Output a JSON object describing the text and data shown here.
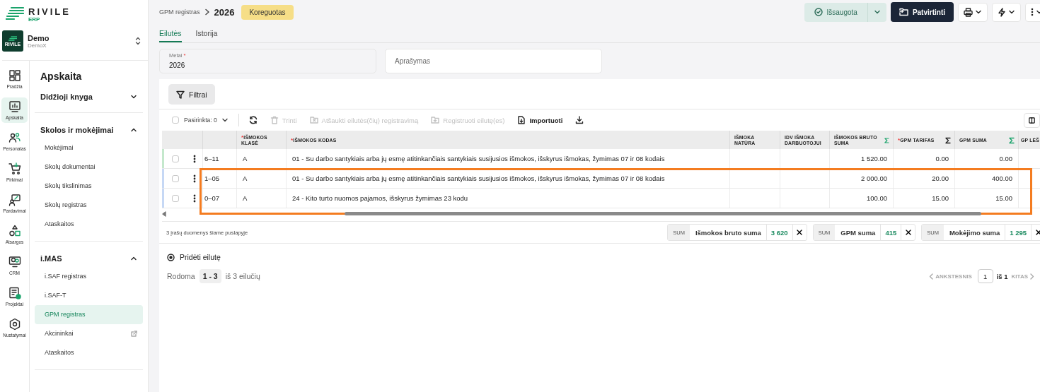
{
  "logo": {
    "name": "RIVILE",
    "product": "ERP"
  },
  "company": {
    "name": "Demo",
    "subtitle": "DemoX",
    "logo_text": "RIVILE"
  },
  "nav_rail": [
    {
      "label": "Pradžia",
      "selected": false
    },
    {
      "label": "Apskaita",
      "selected": true
    },
    {
      "label": "Personalas",
      "selected": false
    },
    {
      "label": "Pirkimai",
      "selected": false
    },
    {
      "label": "Pardavimai",
      "selected": false
    },
    {
      "label": "Atsargos",
      "selected": false
    },
    {
      "label": "CRM",
      "selected": false
    },
    {
      "label": "Projektai",
      "selected": false
    },
    {
      "label": "Nustatymai",
      "selected": false
    }
  ],
  "menu": {
    "title": "Apskaita",
    "groups": [
      {
        "label": "Didžioji knyga",
        "expanded": false
      },
      {
        "label": "Skolos ir mokėjimai",
        "expanded": true,
        "items": [
          {
            "label": "Mokėjimai",
            "selected": false,
            "external": false
          },
          {
            "label": "Skolų dokumentai",
            "selected": false,
            "external": false
          },
          {
            "label": "Skolų tikslinimas",
            "selected": false,
            "external": false
          },
          {
            "label": "Skolų registras",
            "selected": false,
            "external": false
          },
          {
            "label": "Ataskaitos",
            "selected": false,
            "external": false
          }
        ]
      },
      {
        "label": "i.MAS",
        "expanded": true,
        "items": [
          {
            "label": "i.SAF registras",
            "selected": false,
            "external": false
          },
          {
            "label": "i.SAF-T",
            "selected": false,
            "external": false
          },
          {
            "label": "GPM registras",
            "selected": true,
            "external": false
          },
          {
            "label": "Akcininkai",
            "selected": false,
            "external": true
          },
          {
            "label": "Ataskaitos",
            "selected": false,
            "external": false
          }
        ]
      }
    ]
  },
  "breadcrumb": {
    "parent": "GPM registras",
    "current": "2026",
    "status": "Koreguotas"
  },
  "actions": {
    "save": "Išsaugota",
    "confirm": "Patvirtinti"
  },
  "tabs": [
    {
      "label": "Eilutės",
      "selected": true
    },
    {
      "label": "Istorija",
      "selected": false
    }
  ],
  "fields": [
    {
      "label": "Metai",
      "required_mark": "*",
      "value": "2026"
    },
    {
      "placeholder": "Aprašymas"
    }
  ],
  "filter_button": "Filtrai",
  "toolbar": {
    "selection": "Pasirinkta: 0",
    "selected_all": false,
    "actions": [
      {
        "kind": "refresh",
        "disabled": false
      },
      {
        "kind": "delete",
        "label": "Trinti",
        "disabled": true
      },
      {
        "kind": "unregister",
        "label": "Atšaukti eilutės(čių) registravimą",
        "disabled": true
      },
      {
        "kind": "register",
        "label": "Registruoti eilutę(es)",
        "disabled": true
      },
      {
        "kind": "import",
        "label": "Importuoti",
        "disabled": false
      },
      {
        "kind": "download",
        "disabled": false
      }
    ]
  },
  "table": {
    "columns": [
      {},
      {
        "label": "IŠMOKOS KLASĖ",
        "required_mark": "*"
      },
      {
        "label": "IŠMOKOS KODAS",
        "required_mark": "*"
      },
      {
        "label": "IŠMOKA NATŪRA"
      },
      {
        "label": "IDV IŠMOKA DARBUOTOJUI"
      },
      {
        "label": "IŠMOKOS BRUTO SUMA",
        "sum_active": true
      },
      {
        "label": "GPM TARIFAS",
        "required_mark": "*",
        "sum_active": false
      },
      {
        "label": "GPM SUMA",
        "sum_active": true
      },
      {
        "label": "GP LĖŠ"
      }
    ],
    "rows": [
      {
        "selected": false,
        "color": "#c4e8cc",
        "highlighted": false,
        "cells": [
          "6–11",
          "A",
          "01 - Su darbo santykiais arba jų esmę atitinkančiais santykiais susijusios išmokos, išskyrus išmokas, žymimas 07 ir 08 kodais",
          "",
          "",
          "1 520.00",
          "0.00",
          "0.00",
          ""
        ]
      },
      {
        "selected": false,
        "color": "#c6d8f5",
        "highlighted": true,
        "cells": [
          "1–05",
          "A",
          "01 - Su darbo santykiais arba jų esmę atitinkančiais santykiais susijusios išmokos, išskyrus išmokas, žymimas 07 ir 08 kodais",
          "",
          "",
          "2 000.00",
          "20.00",
          "400.00",
          ""
        ]
      },
      {
        "selected": false,
        "color": "#c6d8f5",
        "highlighted": true,
        "cells": [
          "0–07",
          "A",
          "24 - Kito turto nuomos pajamos, išskyrus žymimas 23 kodu",
          "",
          "",
          "100.00",
          "15.00",
          "15.00",
          ""
        ]
      }
    ]
  },
  "footer_note": "3 įrašų duomenys šiame puslapyje",
  "sums": [
    {
      "tag": "SUM",
      "label": "Išmokos bruto suma",
      "value": "3 620"
    },
    {
      "tag": "SUM",
      "label": "GPM suma",
      "value": "415"
    },
    {
      "tag": "SUM",
      "label": "Mokėjimo suma",
      "value": "1 295"
    }
  ],
  "add_row": "Pridėti eilutę",
  "paging": {
    "prefix": "Rodoma",
    "range": "1 - 3",
    "suffix": "iš 3 eilučių",
    "previous": "ANKSTESNIS",
    "page": "1",
    "of": "iš 1",
    "next": "KITAS",
    "previous_disabled": true,
    "next_disabled": true
  }
}
